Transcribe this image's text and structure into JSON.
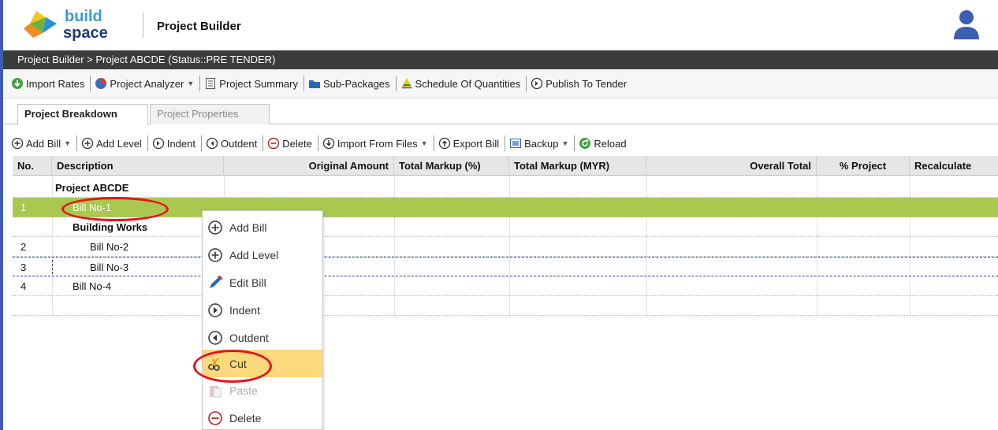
{
  "app": {
    "logo_top": "build",
    "logo_bottom": "space",
    "title": "Project Builder"
  },
  "breadcrumb": "Project Builder > Project ABCDE (Status::PRE TENDER)",
  "toolbar": {
    "import_rates": "Import Rates",
    "project_analyzer": "Project Analyzer",
    "project_summary": "Project Summary",
    "sub_packages": "Sub-Packages",
    "schedule_of_quantities": "Schedule Of Quantities",
    "publish_to_tender": "Publish To Tender"
  },
  "tabs": {
    "breakdown": "Project Breakdown",
    "properties": "Project Properties"
  },
  "bill_toolbar": {
    "add_bill": "Add Bill",
    "add_level": "Add Level",
    "indent": "Indent",
    "outdent": "Outdent",
    "delete": "Delete",
    "import_from_files": "Import From Files",
    "export_bill": "Export Bill",
    "backup": "Backup",
    "reload": "Reload"
  },
  "grid": {
    "columns": [
      "No.",
      "Description",
      "Original Amount",
      "Total Markup (%)",
      "Total Markup (MYR)",
      "Overall Total",
      "% Project",
      "Recalculate"
    ],
    "rows": [
      {
        "no": "",
        "description": "Project ABCDE"
      },
      {
        "no": "1",
        "description": "Bill No-1"
      },
      {
        "no": "",
        "description": "Building Works"
      },
      {
        "no": "2",
        "description": "Bill No-2"
      },
      {
        "no": "3",
        "description": "Bill No-3"
      },
      {
        "no": "4",
        "description": "Bill No-4"
      }
    ]
  },
  "context_menu": {
    "items": [
      "Add Bill",
      "Add Level",
      "Edit Bill",
      "Indent",
      "Outdent",
      "Cut",
      "Paste",
      "Delete"
    ]
  },
  "colors": {
    "accent": "#3a5fb5",
    "selection": "#a8c84f",
    "highlight": "#fcd97c",
    "annotation": "#e8121a"
  }
}
